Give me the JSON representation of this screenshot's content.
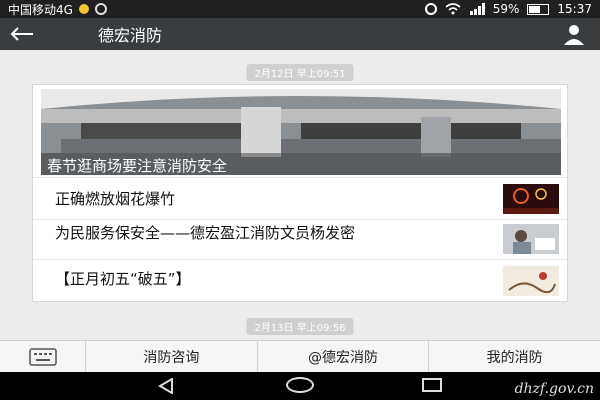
{
  "status_bar": {
    "carrier": "中国移动4G",
    "network": "4G",
    "battery": "59%",
    "battery_level": 0.59,
    "time": "15:37"
  },
  "header": {
    "title": "德宏消防",
    "back_icon": "back-arrow-icon",
    "profile_icon": "person-icon"
  },
  "messages": {
    "timestamp_1": "2月12日 早上09:51",
    "hero_caption": "春节逛商场要注意消防安全",
    "items": [
      {
        "title": "正确燃放烟花爆竹",
        "thumb_icon": "fireworks-thumbnail"
      },
      {
        "title": "为民服务保安全——德宏盈江消防文员杨发密",
        "thumb_icon": "office-worker-thumbnail"
      },
      {
        "title": "【正月初五“破五”】",
        "thumb_icon": "painting-thumbnail"
      }
    ],
    "timestamp_2": "2月13日 早上09:56"
  },
  "bottom_menu": {
    "keyboard_icon": "keyboard-icon",
    "items": [
      "消防咨询",
      "@德宏消防",
      "我的消防"
    ]
  },
  "watermark": "dhzf.gov.cn"
}
